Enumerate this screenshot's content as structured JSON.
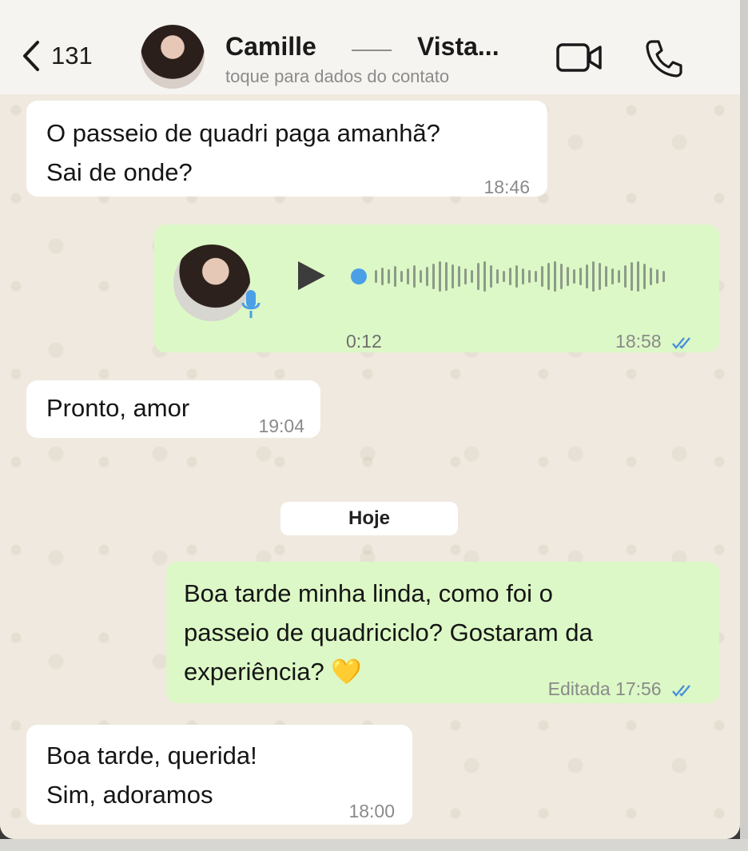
{
  "header": {
    "back_count": "131",
    "contact_name": "Camille",
    "contact_suffix": "Vista...",
    "subtitle": "toque para dados do contato"
  },
  "messages": [
    {
      "direction": "incoming",
      "lines": [
        "O passeio de quadri paga amanhã?",
        "Sai de onde?"
      ],
      "time": "18:46"
    },
    {
      "direction": "outgoing",
      "type": "voice",
      "duration": "0:12",
      "time": "18:58",
      "status": "read"
    },
    {
      "direction": "incoming",
      "lines": [
        "Pronto, amor"
      ],
      "time": "19:04"
    },
    {
      "direction": "outgoing",
      "lines": [
        "Boa tarde minha linda, como foi o",
        "passeio de quadriciclo? Gostaram da",
        "experiência? 💛"
      ],
      "edited_label": "Editada",
      "time": "17:56",
      "status": "read"
    },
    {
      "direction": "incoming",
      "lines": [
        "Boa tarde, querida!",
        "Sim, adoramos"
      ],
      "time": "18:00"
    }
  ],
  "day_separator": "Hoje",
  "colors": {
    "incoming_bubble": "#ffffff",
    "outgoing_bubble": "#dcf8c6",
    "read_ticks": "#4a90d9",
    "voice_accent": "#4a9fe6"
  },
  "icons": [
    "chevron-left-icon",
    "video-camera-icon",
    "phone-icon",
    "play-icon",
    "microphone-icon",
    "double-check-icon"
  ]
}
